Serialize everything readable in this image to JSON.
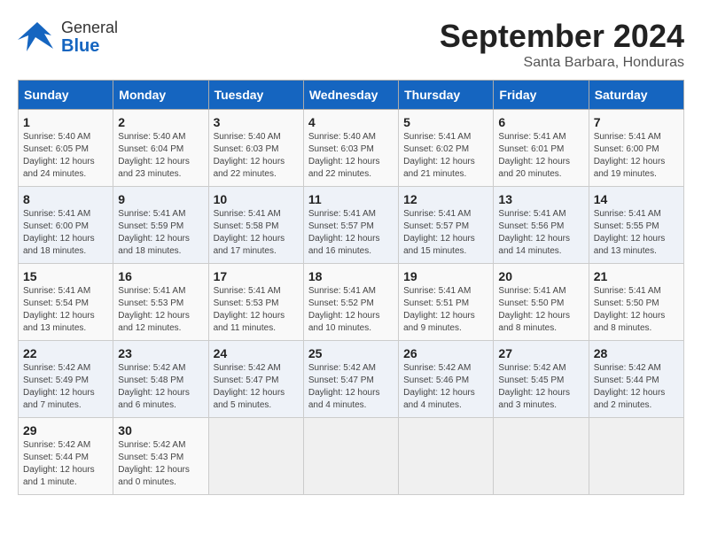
{
  "header": {
    "logo_general": "General",
    "logo_blue": "Blue",
    "month_year": "September 2024",
    "location": "Santa Barbara, Honduras"
  },
  "days_of_week": [
    "Sunday",
    "Monday",
    "Tuesday",
    "Wednesday",
    "Thursday",
    "Friday",
    "Saturday"
  ],
  "weeks": [
    [
      {
        "day": "1",
        "sunrise": "5:40 AM",
        "sunset": "6:05 PM",
        "daylight": "12 hours and 24 minutes."
      },
      {
        "day": "2",
        "sunrise": "5:40 AM",
        "sunset": "6:04 PM",
        "daylight": "12 hours and 23 minutes."
      },
      {
        "day": "3",
        "sunrise": "5:40 AM",
        "sunset": "6:03 PM",
        "daylight": "12 hours and 22 minutes."
      },
      {
        "day": "4",
        "sunrise": "5:40 AM",
        "sunset": "6:03 PM",
        "daylight": "12 hours and 22 minutes."
      },
      {
        "day": "5",
        "sunrise": "5:41 AM",
        "sunset": "6:02 PM",
        "daylight": "12 hours and 21 minutes."
      },
      {
        "day": "6",
        "sunrise": "5:41 AM",
        "sunset": "6:01 PM",
        "daylight": "12 hours and 20 minutes."
      },
      {
        "day": "7",
        "sunrise": "5:41 AM",
        "sunset": "6:00 PM",
        "daylight": "12 hours and 19 minutes."
      }
    ],
    [
      {
        "day": "8",
        "sunrise": "5:41 AM",
        "sunset": "6:00 PM",
        "daylight": "12 hours and 18 minutes."
      },
      {
        "day": "9",
        "sunrise": "5:41 AM",
        "sunset": "5:59 PM",
        "daylight": "12 hours and 18 minutes."
      },
      {
        "day": "10",
        "sunrise": "5:41 AM",
        "sunset": "5:58 PM",
        "daylight": "12 hours and 17 minutes."
      },
      {
        "day": "11",
        "sunrise": "5:41 AM",
        "sunset": "5:57 PM",
        "daylight": "12 hours and 16 minutes."
      },
      {
        "day": "12",
        "sunrise": "5:41 AM",
        "sunset": "5:57 PM",
        "daylight": "12 hours and 15 minutes."
      },
      {
        "day": "13",
        "sunrise": "5:41 AM",
        "sunset": "5:56 PM",
        "daylight": "12 hours and 14 minutes."
      },
      {
        "day": "14",
        "sunrise": "5:41 AM",
        "sunset": "5:55 PM",
        "daylight": "12 hours and 13 minutes."
      }
    ],
    [
      {
        "day": "15",
        "sunrise": "5:41 AM",
        "sunset": "5:54 PM",
        "daylight": "12 hours and 13 minutes."
      },
      {
        "day": "16",
        "sunrise": "5:41 AM",
        "sunset": "5:53 PM",
        "daylight": "12 hours and 12 minutes."
      },
      {
        "day": "17",
        "sunrise": "5:41 AM",
        "sunset": "5:53 PM",
        "daylight": "12 hours and 11 minutes."
      },
      {
        "day": "18",
        "sunrise": "5:41 AM",
        "sunset": "5:52 PM",
        "daylight": "12 hours and 10 minutes."
      },
      {
        "day": "19",
        "sunrise": "5:41 AM",
        "sunset": "5:51 PM",
        "daylight": "12 hours and 9 minutes."
      },
      {
        "day": "20",
        "sunrise": "5:41 AM",
        "sunset": "5:50 PM",
        "daylight": "12 hours and 8 minutes."
      },
      {
        "day": "21",
        "sunrise": "5:41 AM",
        "sunset": "5:50 PM",
        "daylight": "12 hours and 8 minutes."
      }
    ],
    [
      {
        "day": "22",
        "sunrise": "5:42 AM",
        "sunset": "5:49 PM",
        "daylight": "12 hours and 7 minutes."
      },
      {
        "day": "23",
        "sunrise": "5:42 AM",
        "sunset": "5:48 PM",
        "daylight": "12 hours and 6 minutes."
      },
      {
        "day": "24",
        "sunrise": "5:42 AM",
        "sunset": "5:47 PM",
        "daylight": "12 hours and 5 minutes."
      },
      {
        "day": "25",
        "sunrise": "5:42 AM",
        "sunset": "5:47 PM",
        "daylight": "12 hours and 4 minutes."
      },
      {
        "day": "26",
        "sunrise": "5:42 AM",
        "sunset": "5:46 PM",
        "daylight": "12 hours and 4 minutes."
      },
      {
        "day": "27",
        "sunrise": "5:42 AM",
        "sunset": "5:45 PM",
        "daylight": "12 hours and 3 minutes."
      },
      {
        "day": "28",
        "sunrise": "5:42 AM",
        "sunset": "5:44 PM",
        "daylight": "12 hours and 2 minutes."
      }
    ],
    [
      {
        "day": "29",
        "sunrise": "5:42 AM",
        "sunset": "5:44 PM",
        "daylight": "12 hours and 1 minute."
      },
      {
        "day": "30",
        "sunrise": "5:42 AM",
        "sunset": "5:43 PM",
        "daylight": "12 hours and 0 minutes."
      },
      {
        "day": "",
        "sunrise": "",
        "sunset": "",
        "daylight": ""
      },
      {
        "day": "",
        "sunrise": "",
        "sunset": "",
        "daylight": ""
      },
      {
        "day": "",
        "sunrise": "",
        "sunset": "",
        "daylight": ""
      },
      {
        "day": "",
        "sunrise": "",
        "sunset": "",
        "daylight": ""
      },
      {
        "day": "",
        "sunrise": "",
        "sunset": "",
        "daylight": ""
      }
    ]
  ],
  "labels": {
    "sunrise_prefix": "Sunrise:",
    "sunset_prefix": "Sunset:",
    "daylight_prefix": "Daylight:"
  }
}
